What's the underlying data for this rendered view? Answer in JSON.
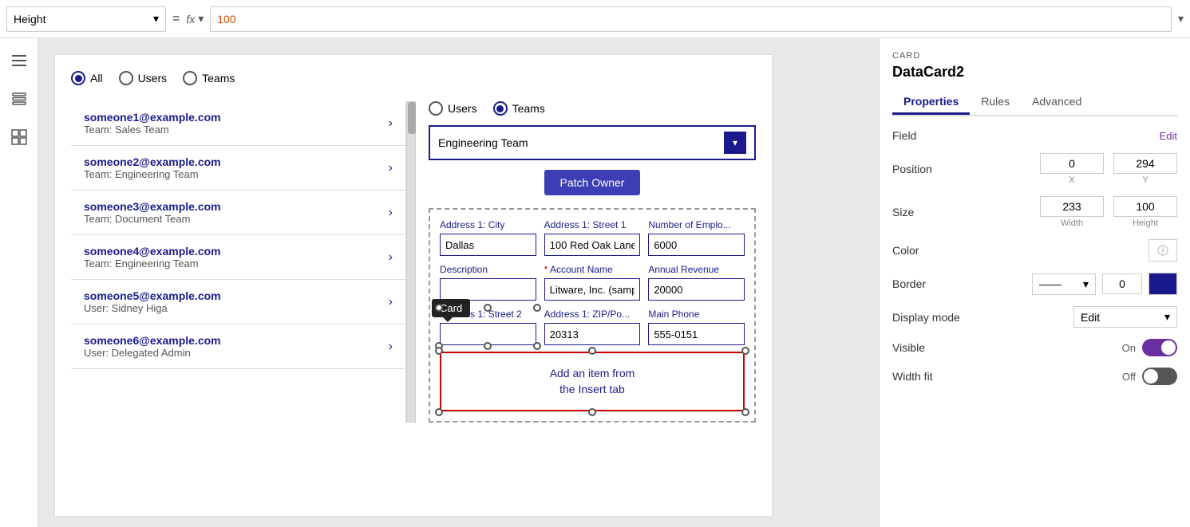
{
  "topbar": {
    "height_label": "Height",
    "equals": "=",
    "fx_label": "fx",
    "formula_value": "100",
    "dropdown_arrow": "▾"
  },
  "sidebar": {
    "icons": [
      "≡",
      "⊞",
      "⊟"
    ]
  },
  "canvas": {
    "radio_all": "All",
    "radio_users": "Users",
    "radio_teams": "Teams",
    "selected_radio": "All",
    "users": [
      {
        "email": "someone1@example.com",
        "team": "Team: Sales Team"
      },
      {
        "email": "someone2@example.com",
        "team": "Team: Engineering Team"
      },
      {
        "email": "someone3@example.com",
        "team": "Team: Document Team"
      },
      {
        "email": "someone4@example.com",
        "team": "Team: Engineering Team"
      },
      {
        "email": "someone5@example.com",
        "team": "User: Sidney Higa"
      },
      {
        "email": "someone6@example.com",
        "team": "User: Delegated Admin"
      }
    ],
    "form_radio_users": "Users",
    "form_radio_teams": "Teams",
    "form_radio_selected": "Teams",
    "dropdown_value": "Engineering Team",
    "patch_owner_btn": "Patch Owner",
    "card_tooltip": "Card",
    "insert_text_line1": "Add an item from",
    "insert_text_line2": "the Insert tab",
    "fields": [
      {
        "label": "Address 1: City",
        "value": "Dallas",
        "required": false
      },
      {
        "label": "Address 1: Street 1",
        "value": "100 Red Oak Lane",
        "required": false
      },
      {
        "label": "Number of Emplo...",
        "value": "6000",
        "required": false
      },
      {
        "label": "Description",
        "value": "",
        "required": false
      },
      {
        "label": "Account Name",
        "value": "Litware, Inc. (sample",
        "required": true
      },
      {
        "label": "Annual Revenue",
        "value": "20000",
        "required": false
      },
      {
        "label": "Address 1: Street 2",
        "value": "",
        "required": false
      },
      {
        "label": "Address 1: ZIP/Po...",
        "value": "20313",
        "required": false
      },
      {
        "label": "Main Phone",
        "value": "555-0151",
        "required": false
      }
    ]
  },
  "props": {
    "card_label": "CARD",
    "title": "DataCard2",
    "tabs": [
      "Properties",
      "Rules",
      "Advanced"
    ],
    "active_tab": "Properties",
    "field_label": "Field",
    "edit_link": "Edit",
    "position_label": "Position",
    "pos_x": "0",
    "pos_y": "294",
    "x_label": "X",
    "y_label": "Y",
    "size_label": "Size",
    "size_width": "233",
    "size_height": "100",
    "width_label": "Width",
    "height_label": "Height",
    "color_label": "Color",
    "border_label": "Border",
    "border_width": "0",
    "display_mode_label": "Display mode",
    "display_mode_value": "Edit",
    "visible_label": "Visible",
    "visible_on": "On",
    "width_fit_label": "Width fit",
    "width_fit_off": "Off"
  }
}
